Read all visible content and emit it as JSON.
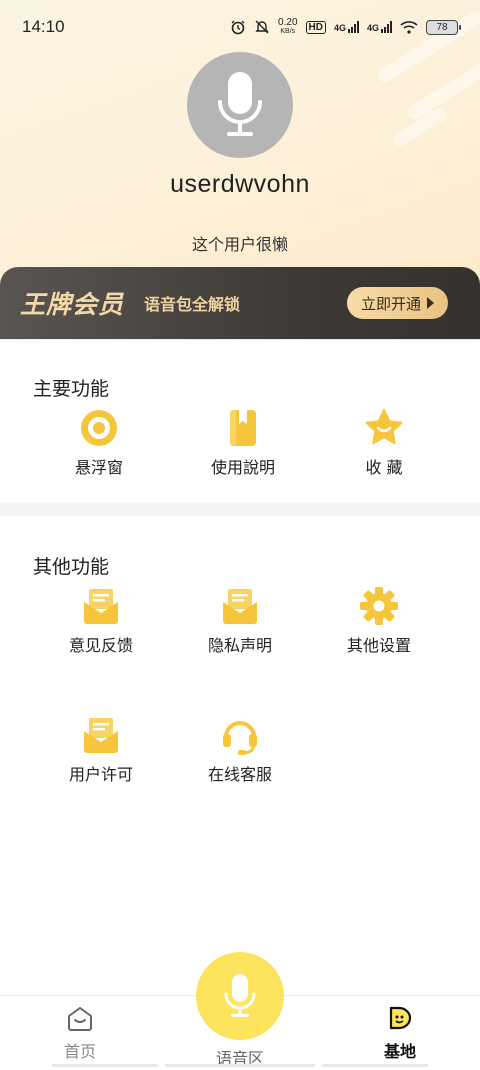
{
  "status_bar": {
    "time": "14:10",
    "net_speed_value": "0.20",
    "net_speed_unit": "KB/s",
    "hd_label": "HD",
    "sim1_label": "4G",
    "sim2_label": "4G",
    "battery": "78"
  },
  "profile": {
    "username": "userdwvohn",
    "bio": "这个用户很懒"
  },
  "vip": {
    "title": "王牌会员",
    "subtitle": "语音包全解锁",
    "button_label": "立即开通"
  },
  "main_functions": {
    "title": "主要功能",
    "items": [
      {
        "label": "悬浮窗",
        "icon": "floating-window-icon"
      },
      {
        "label": "使用說明",
        "icon": "manual-book-icon"
      },
      {
        "label": "收 藏",
        "icon": "favorite-star-icon"
      }
    ]
  },
  "other_functions": {
    "title": "其他功能",
    "items": [
      {
        "label": "意见反馈",
        "icon": "feedback-envelope-icon"
      },
      {
        "label": "隐私声明",
        "icon": "privacy-envelope-icon"
      },
      {
        "label": "其他设置",
        "icon": "gear-icon"
      },
      {
        "label": "用户许可",
        "icon": "license-envelope-icon"
      },
      {
        "label": "在线客服",
        "icon": "headset-icon"
      }
    ]
  },
  "tabbar": {
    "home_label": "首页",
    "voice_label": "语音区",
    "base_label": "基地"
  },
  "colors": {
    "accent_yellow": "#fde45c",
    "icon_yellow": "#f7c53c",
    "vip_dark": "#3e3a36",
    "vip_gold": "#f3d9a8"
  }
}
